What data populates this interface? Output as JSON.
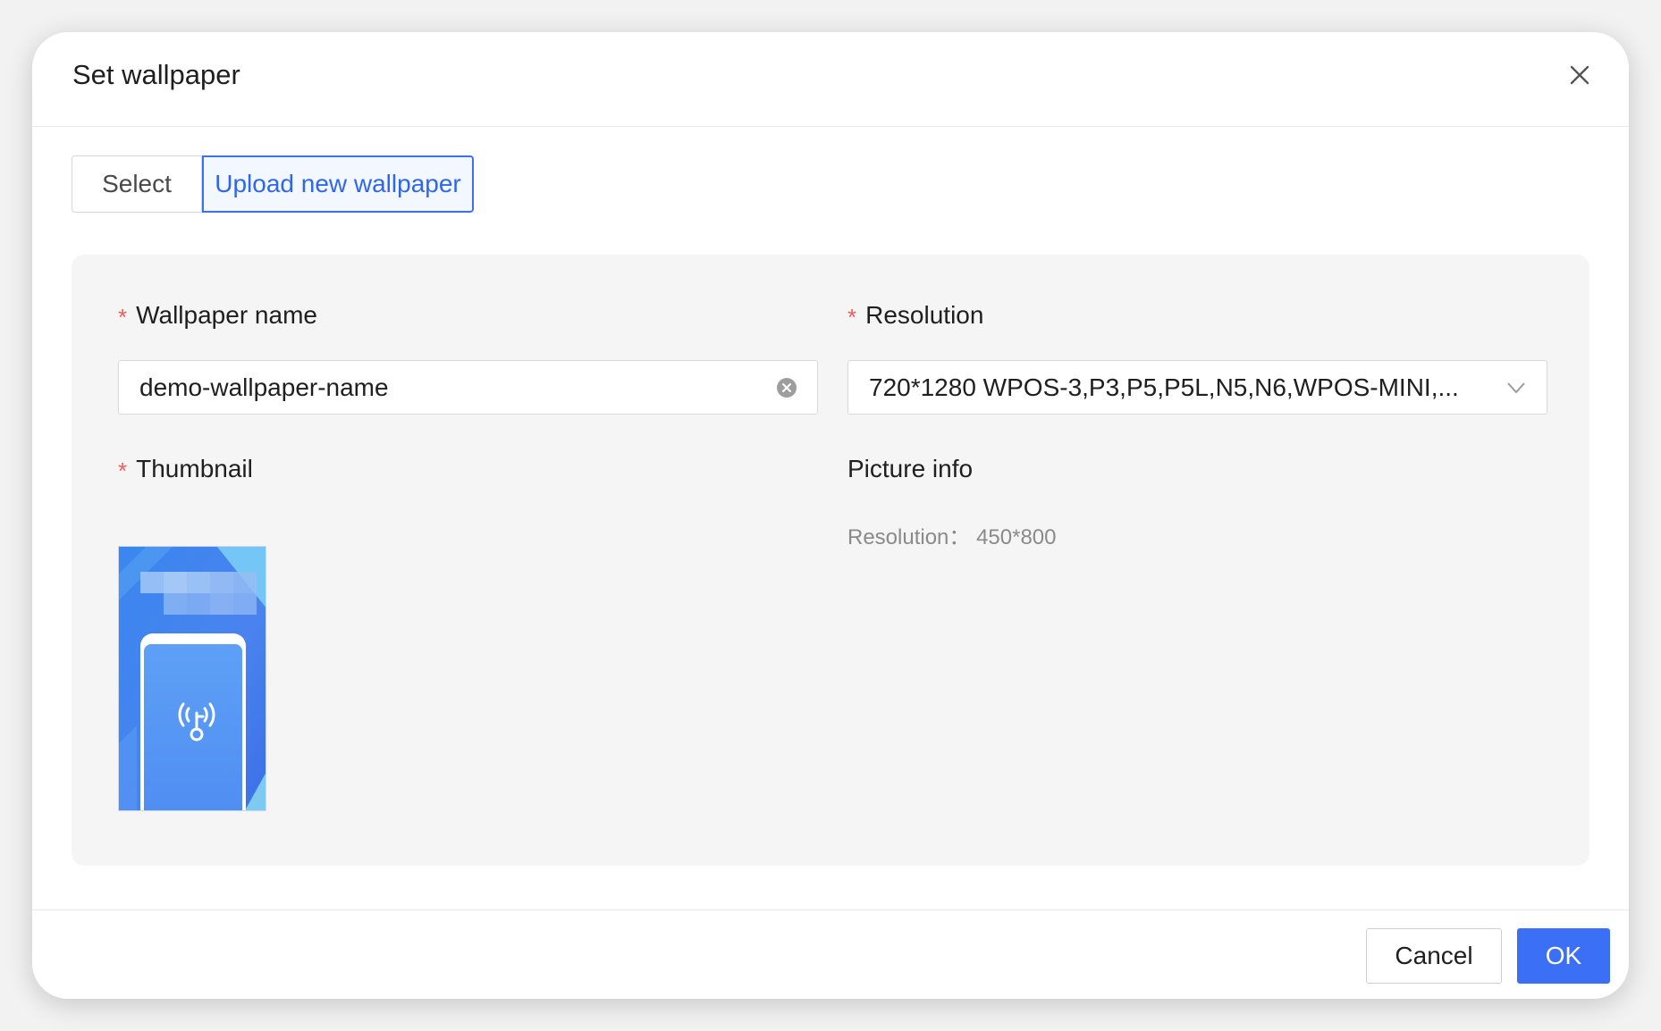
{
  "dialog": {
    "title": "Set wallpaper"
  },
  "tabs": [
    {
      "label": "Select",
      "active": false
    },
    {
      "label": "Upload new wallpaper",
      "active": true
    }
  ],
  "form": {
    "wallpaper_name": {
      "label": "Wallpaper name",
      "required_mark": "*",
      "value": "demo-wallpaper-name"
    },
    "resolution": {
      "label": "Resolution",
      "required_mark": "*",
      "value": "720*1280 WPOS-3,P3,P5,P5L,N5,N6,WPOS-MINI,..."
    },
    "thumbnail": {
      "label": "Thumbnail",
      "required_mark": "*"
    },
    "picture_info": {
      "label": "Picture info",
      "resolution_text": "Resolution： 450*800"
    }
  },
  "footer": {
    "cancel_label": "Cancel",
    "ok_label": "OK"
  },
  "colors": {
    "accent": "#3b6ff5",
    "required": "#f05a5a",
    "panel_bg": "#f5f5f5"
  }
}
